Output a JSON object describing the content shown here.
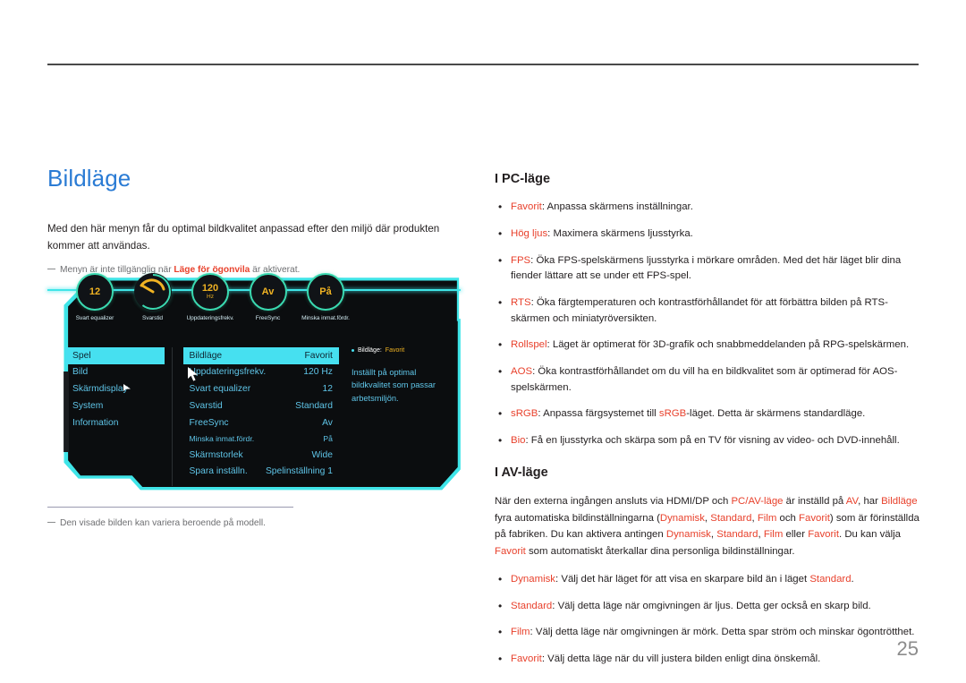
{
  "page": {
    "number": "25"
  },
  "left": {
    "title": "Bildläge",
    "intro": "Med den här menyn får du optimal bildkvalitet anpassad efter den miljö där produkten kommer att användas.",
    "note_pre": "Menyn är inte tillgänglig när ",
    "note_kw": "Läge för ögonvila",
    "note_post": " är aktiverat.",
    "bottom_note": "Den visade bilden kan variera beroende på modell."
  },
  "osd": {
    "icons": [
      {
        "label": "Svart equalizer",
        "value": "12",
        "unit": "",
        "type": "value"
      },
      {
        "label": "Svarstid",
        "value": "",
        "unit": "",
        "type": "gauge"
      },
      {
        "label": "Uppdateringsfrekv.",
        "value": "120",
        "unit": "Hz",
        "type": "value"
      },
      {
        "label": "FreeSync",
        "value": "Av",
        "unit": "",
        "type": "value"
      },
      {
        "label": "Minska inmat.fördr.",
        "value": "På",
        "unit": "",
        "type": "value"
      }
    ],
    "nav": [
      {
        "label": "Spel",
        "selected": true
      },
      {
        "label": "Bild",
        "selected": false
      },
      {
        "label": "Skärmdisplay",
        "selected": false
      },
      {
        "label": "System",
        "selected": false
      },
      {
        "label": "Information",
        "selected": false
      }
    ],
    "rows": [
      {
        "label": "Bildläge",
        "value": "Favorit",
        "selected": true,
        "tiny": false
      },
      {
        "label": "Uppdateringsfrekv.",
        "value": "120 Hz",
        "selected": false,
        "tiny": false
      },
      {
        "label": "Svart equalizer",
        "value": "12",
        "selected": false,
        "tiny": false
      },
      {
        "label": "Svarstid",
        "value": "Standard",
        "selected": false,
        "tiny": false
      },
      {
        "label": "FreeSync",
        "value": "Av",
        "selected": false,
        "tiny": false
      },
      {
        "label": "Minska inmat.fördr.",
        "value": "På",
        "selected": false,
        "tiny": true
      },
      {
        "label": "Skärmstorlek",
        "value": "Wide",
        "selected": false,
        "tiny": false
      },
      {
        "label": "Spara inställn.",
        "value": "Spelinställning 1",
        "selected": false,
        "tiny": false
      }
    ],
    "hint": {
      "title_label": "Bildläge:",
      "title_value": "Favorit",
      "body": "Inställt på optimal bildkvalitet som passar arbetsmiljön."
    }
  },
  "right": {
    "pc_heading": "I PC-läge",
    "pc_items": [
      {
        "kw": "Favorit",
        "text": ": Anpassa skärmens inställningar."
      },
      {
        "kw": "Hög ljus",
        "text": ": Maximera skärmens ljusstyrka."
      },
      {
        "kw": "FPS",
        "text": ": Öka FPS-spelskärmens ljusstyrka i mörkare områden. Med det här läget blir dina fiender lättare att se under ett FPS-spel."
      },
      {
        "kw": "RTS",
        "text": ": Öka färgtemperaturen och kontrastförhållandet för att förbättra bilden på RTS-skärmen och miniatyröversikten."
      },
      {
        "kw": "Rollspel",
        "text": ": Läget är optimerat för 3D-grafik och snabbmeddelanden på RPG-spelskärmen."
      },
      {
        "kw": "AOS",
        "text": ": Öka kontrastförhållandet om du vill ha en bildkvalitet som är optimerad för AOS-spelskärmen."
      },
      {
        "kw": "sRGB",
        "text": ": Anpassa färgsystemet till sRGB-läget. Detta är skärmens standardläge."
      },
      {
        "kw": "Bio",
        "text": ": Få en ljusstyrka och skärpa som på en TV för visning av video- och DVD-innehåll."
      }
    ],
    "av_heading": "I AV-läge",
    "av_paragraph": "När den externa ingången ansluts via HDMI/DP och PC/AV-läge är inställd på AV, har Bildläge fyra automatiska bildinställningarna (Dynamisk, Standard, Film och Favorit) som är förinställda på fabriken. Du kan aktivera antingen Dynamisk, Standard, Film eller Favorit. Du kan välja Favorit som automatiskt återkallar dina personliga bildinställningar.",
    "av_items": [
      {
        "kw": "Dynamisk",
        "text": ": Välj det här läget för att visa en skarpare bild än i läget Standard."
      },
      {
        "kw": "Standard",
        "text": ": Välj detta läge när omgivningen är ljus. Detta ger också en skarp bild."
      },
      {
        "kw": "Film",
        "text": ": Välj detta läge när omgivningen är mörk. Detta spar ström och minskar ögontrötthet."
      },
      {
        "kw": "Favorit",
        "text": ": Välj detta läge när du vill justera bilden enligt dina önskemål."
      }
    ]
  },
  "colors": {
    "heading_blue": "#2a7bd4",
    "keyword_orange": "#e8412c",
    "osd_cyan": "#46e0f0",
    "osd_amber": "#f0b323"
  }
}
